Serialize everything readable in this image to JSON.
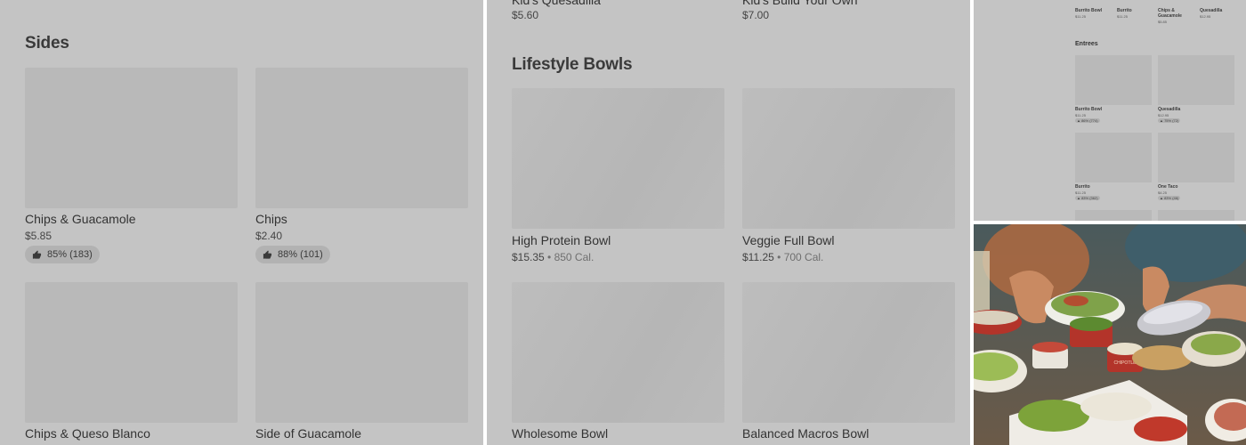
{
  "panel1": {
    "section_title": "Sides",
    "items": [
      {
        "name": "Chips & Guacamole",
        "price": "$5.85",
        "rating": "85% (183)"
      },
      {
        "name": "Chips",
        "price": "$2.40",
        "rating": "88% (101)"
      },
      {
        "name": "Chips & Queso Blanco"
      },
      {
        "name": "Side of Guacamole"
      }
    ]
  },
  "panel2": {
    "top_items": [
      {
        "name": "Kid's Quesadilla",
        "price": "$5.60"
      },
      {
        "name": "Kid's Build Your Own",
        "price": "$7.00"
      }
    ],
    "section_title": "Lifestyle Bowls",
    "items": [
      {
        "name": "High Protein Bowl",
        "price": "$15.35",
        "calories": "850 Cal."
      },
      {
        "name": "Veggie Full Bowl",
        "price": "$11.25",
        "calories": "700 Cal."
      },
      {
        "name": "Wholesome Bowl"
      },
      {
        "name": "Balanced Macros Bowl"
      }
    ],
    "separator": " • "
  },
  "panel3": {
    "top_row": [
      {
        "name": "Burrito Bowl",
        "price": "$11.25"
      },
      {
        "name": "Burrito",
        "price": "$11.25"
      },
      {
        "name": "Chips & Guacamole",
        "price": "$5.85"
      },
      {
        "name": "Quesadilla",
        "price": "$12.95"
      }
    ],
    "section_title": "Entrees",
    "items": [
      {
        "name": "Burrito Bowl",
        "price": "$11.25",
        "rating": "86% (774)"
      },
      {
        "name": "Quesadilla",
        "price": "$12.95",
        "rating": "75% (72)"
      },
      {
        "name": "Burrito",
        "price": "$11.25",
        "rating": "83% (362)"
      },
      {
        "name": "One Taco",
        "price": "$4.25",
        "rating": "83% (46)"
      }
    ]
  },
  "photo": {
    "cup_label": "CHIPOTLE"
  },
  "colors": {
    "overlay": "#c4c4c4",
    "placeholder": "#b9b9b9",
    "text": "#333333"
  }
}
